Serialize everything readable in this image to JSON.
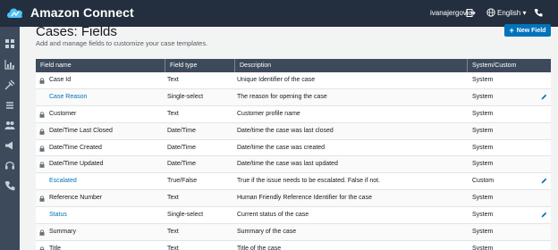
{
  "header": {
    "brand": "Amazon Connect",
    "user": "ivanajergovic",
    "language": "English",
    "language_caret": "▾"
  },
  "sidebar": {
    "icons": [
      "dashboard-icon",
      "metrics-icon",
      "routing-icon",
      "channels-icon",
      "users-icon",
      "campaigns-icon",
      "headset-icon",
      "phone-numbers-icon"
    ]
  },
  "page": {
    "title": "Cases: Fields",
    "subtitle": "Add and manage fields to customize your case templates.",
    "new_field_label": "New Field",
    "new_field_icon": "+"
  },
  "table": {
    "columns": [
      "Field name",
      "Field type",
      "Description",
      "System/Custom"
    ],
    "rows": [
      {
        "name": "Case Id",
        "type": "Text",
        "description": "Unique Identifier of the case",
        "origin": "System",
        "locked": true,
        "editable": false
      },
      {
        "name": "Case Reason",
        "type": "Single-select",
        "description": "The reason for opening the case",
        "origin": "System",
        "locked": false,
        "editable": true
      },
      {
        "name": "Customer",
        "type": "Text",
        "description": "Customer profile name",
        "origin": "System",
        "locked": true,
        "editable": false
      },
      {
        "name": "Date/Time Last Closed",
        "type": "Date/Time",
        "description": "Date/time the case was last closed",
        "origin": "System",
        "locked": true,
        "editable": false
      },
      {
        "name": "Date/Time Created",
        "type": "Date/Time",
        "description": "Date/time the case was created",
        "origin": "System",
        "locked": true,
        "editable": false
      },
      {
        "name": "Date/Time Updated",
        "type": "Date/Time",
        "description": "Date/time the case was last updated",
        "origin": "System",
        "locked": true,
        "editable": false
      },
      {
        "name": "Escalated",
        "type": "True/False",
        "description": "True if the issue needs to be escalated. False if not.",
        "origin": "Custom",
        "locked": false,
        "editable": true
      },
      {
        "name": "Reference Number",
        "type": "Text",
        "description": "Human Friendly Reference Identifier for the case",
        "origin": "System",
        "locked": true,
        "editable": false
      },
      {
        "name": "Status",
        "type": "Single-select",
        "description": "Current status of the case",
        "origin": "System",
        "locked": false,
        "editable": true
      },
      {
        "name": "Summary",
        "type": "Text",
        "description": "Summary of the case",
        "origin": "System",
        "locked": true,
        "editable": false
      },
      {
        "name": "Title",
        "type": "Text",
        "description": "Title of the case",
        "origin": "System",
        "locked": true,
        "editable": false
      }
    ]
  },
  "colors": {
    "topbar": "#232f3e",
    "sidebar": "#3d4a5c",
    "link": "#0073bb",
    "primary_button": "#0073bb"
  }
}
